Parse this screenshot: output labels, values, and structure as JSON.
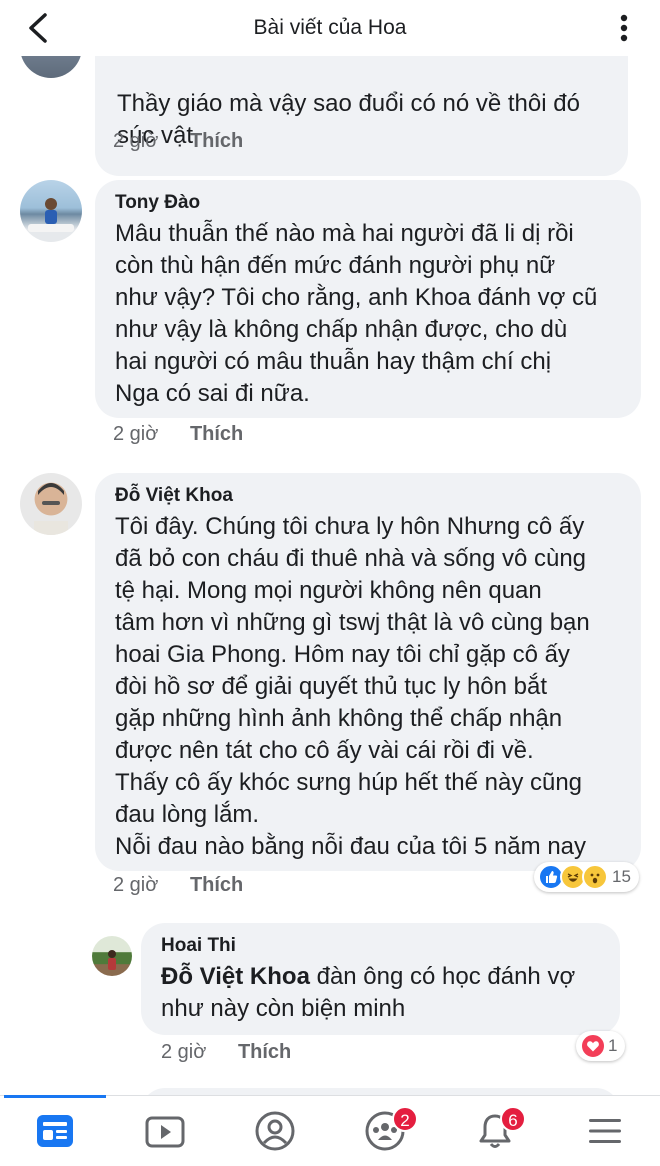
{
  "header": {
    "title": "Bài viết của Hoa"
  },
  "comments": [
    {
      "text": "Thầy giáo mà vậy sao đuổi có nó về thôi đó\nsúc vật",
      "time": "2 giờ",
      "like": "Thích"
    },
    {
      "author": "Tony Đào",
      "text": "Mâu thuẫn thế nào mà hai người đã li dị rồi\ncòn thù hận đến mức đánh người phụ nữ\nnhư vậy? Tôi cho rằng, anh Khoa đánh vợ cũ\nnhư vậy là không chấp nhận được, cho dù\nhai người có mâu thuẫn hay thậm chí chị\nNga có sai đi nữa.",
      "time": "2 giờ",
      "like": "Thích"
    },
    {
      "author": "Đỗ Việt Khoa",
      "text": "Tôi đây. Chúng tôi chưa ly hôn Nhưng cô ấy\nđã bỏ con cháu đi thuê nhà và sống vô cùng\ntệ hại.  Mong mọi người không nên quan\ntâm hơn vì những gì tswj thật là vô cùng bạn\nhoai Gia Phong. Hôm nay tôi chỉ gặp cô ấy\nđòi hồ sơ để giải quyết thủ tục ly hôn bắt\ngặp những hình ảnh không thể chấp nhận\nđược nên tát cho cô ấy vài cái rồi đi về.\nThấy cô ấy khóc sưng húp hết thế này cũng\nđau lòng lắm.\nNỗi đau nào bằng nỗi đau của tôi 5 năm nay",
      "time": "2 giờ",
      "like": "Thích",
      "reactions": {
        "icons": [
          "like",
          "haha",
          "wow"
        ],
        "count": "15"
      }
    }
  ],
  "reply": {
    "author": "Hoai Thi",
    "mention": "Đỗ Việt Khoa",
    "text": " đàn ông có học đánh vợ\nnhư này còn biện minh",
    "time": "2 giờ",
    "like": "Thích",
    "reactions": {
      "icons": [
        "love"
      ],
      "count": "1"
    }
  },
  "nav": {
    "items": [
      "feed",
      "watch",
      "profile",
      "groups",
      "notifications",
      "menu"
    ],
    "groups_badge": "2",
    "notifications_badge": "6",
    "active": "feed"
  },
  "colors": {
    "accent": "#1877f2",
    "badge": "#e41e3f",
    "bubble": "#f0f2f5",
    "meta": "#65676b"
  }
}
